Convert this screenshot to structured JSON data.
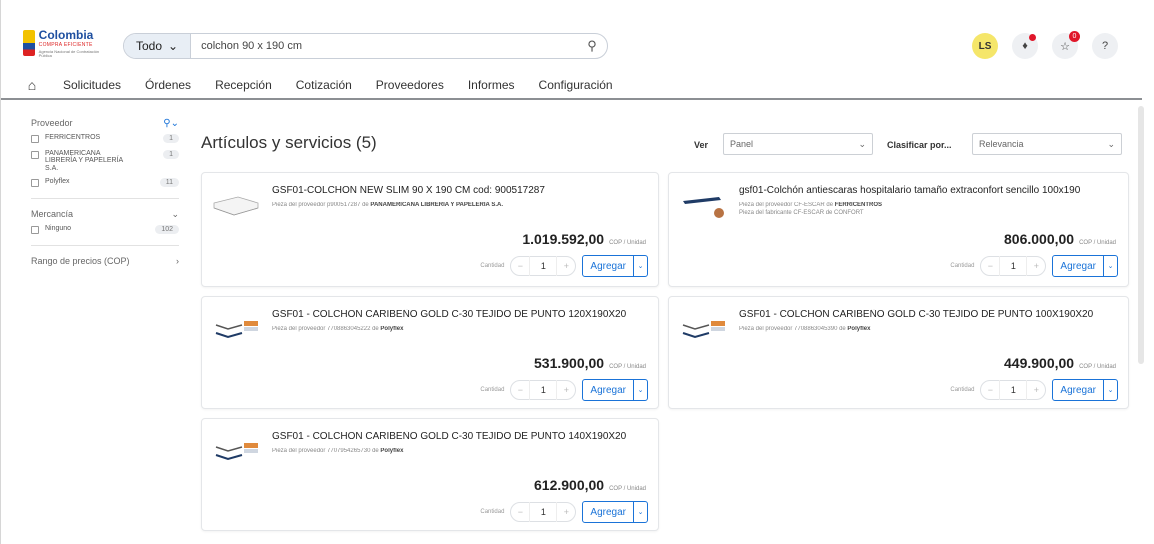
{
  "header": {
    "logo_main": "Colombia",
    "logo_sub": "COMPRA EFICIENTE",
    "logo_sub2": "Agencia Nacional de Contratación Pública",
    "search_scope": "Todo",
    "search_value": "colchon 90 x 190 cm",
    "avatar_initials": "LS",
    "cart_count": "0",
    "help": "?"
  },
  "nav": {
    "items": [
      "Solicitudes",
      "Órdenes",
      "Recepción",
      "Cotización",
      "Proveedores",
      "Informes",
      "Configuración"
    ]
  },
  "sidebar": {
    "proveedor_title": "Proveedor",
    "proveedor_items": [
      {
        "label": "FERRICENTROS",
        "count": "1"
      },
      {
        "label": "PANAMERICANA LIBRERÍA Y PAPELERÍA S.A.",
        "count": "1"
      },
      {
        "label": "Polyflex",
        "count": "11"
      }
    ],
    "mercancia_title": "Mercancía",
    "mercancia_items": [
      {
        "label": "Ninguno",
        "count": "102"
      }
    ],
    "precio_title": "Rango de precios (COP)"
  },
  "main": {
    "title": "Artículos y servicios (5)",
    "ver_label": "Ver",
    "ver_value": "Panel",
    "sort_label": "Clasificar por...",
    "sort_value": "Relevancia"
  },
  "cards": [
    {
      "title": "GSF01-COLCHON NEW SLIM 90 X 190 CM cod: 900517287",
      "sub_prefix": "Pieza del proveedor p900517287 de ",
      "sub_supplier": "PANAMERICANA LIBRERÍA Y PAPELERÍA S.A.",
      "sub2": "",
      "price": "1.019.592,00",
      "unit": "COP / Unidad",
      "qty_label": "Cantidad",
      "qty": "1",
      "add_label": "Agregar"
    },
    {
      "title": "gsf01-Colchón antiescaras hospitalario tamaño extraconfort sencillo 100x190",
      "sub_prefix": "Pieza del proveedor CF-ESCAR de ",
      "sub_supplier": "FERRICENTROS",
      "sub2": "Pieza del fabricante CF-ESCAR de CONFORT",
      "price": "806.000,00",
      "unit": "COP / Unidad",
      "qty_label": "Cantidad",
      "qty": "1",
      "add_label": "Agregar"
    },
    {
      "title": "GSF01 - COLCHON CARIBEÑO GOLD C-30 TEJIDO DE PUNTO 120X190X20",
      "sub_prefix": "Pieza del proveedor 7708863045222 de ",
      "sub_supplier": "Polyflex",
      "sub2": "",
      "price": "531.900,00",
      "unit": "COP / Unidad",
      "qty_label": "Cantidad",
      "qty": "1",
      "add_label": "Agregar"
    },
    {
      "title": "GSF01 - COLCHON CARIBEÑO GOLD C-30 TEJIDO DE PUNTO 100X190X20",
      "sub_prefix": "Pieza del proveedor 7708863045390 de ",
      "sub_supplier": "Polyflex",
      "sub2": "",
      "price": "449.900,00",
      "unit": "COP / Unidad",
      "qty_label": "Cantidad",
      "qty": "1",
      "add_label": "Agregar"
    },
    {
      "title": "GSF01 - COLCHON CARIBEÑO GOLD C-30 TEJIDO DE PUNTO 140X190X20",
      "sub_prefix": "Pieza del proveedor 7707954265730 de ",
      "sub_supplier": "Polyflex",
      "sub2": "",
      "price": "612.900,00",
      "unit": "COP / Unidad",
      "qty_label": "Cantidad",
      "qty": "1",
      "add_label": "Agregar"
    }
  ],
  "colors": {
    "accent": "#1a73d8",
    "badge": "#e0172a",
    "avatar_bg": "#f5e66a"
  }
}
